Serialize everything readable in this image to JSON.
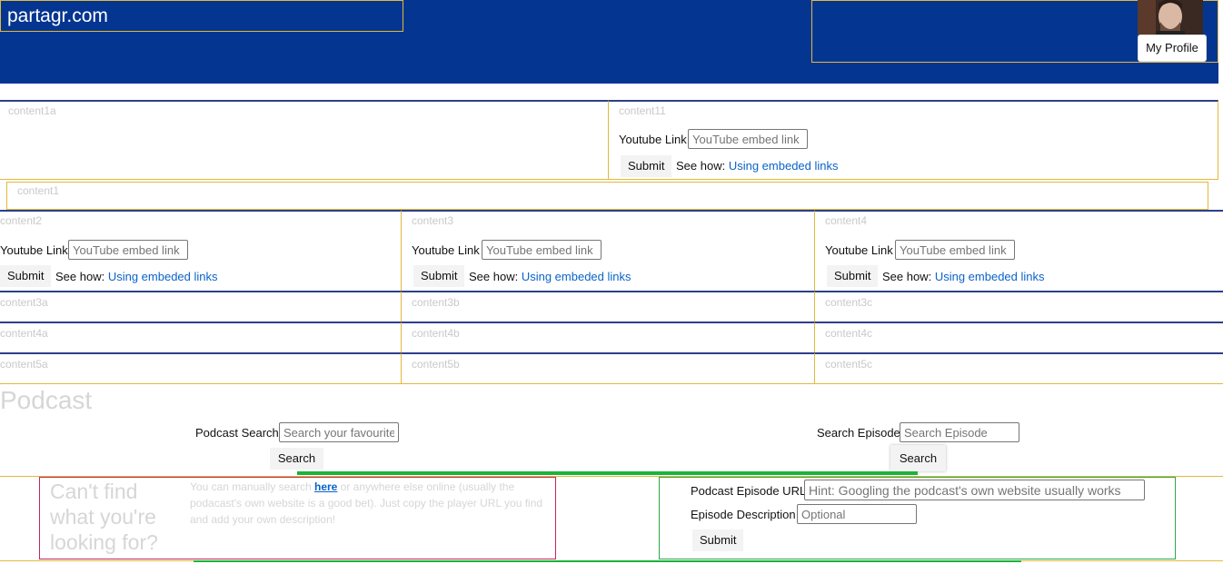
{
  "header": {
    "site_title": "partagr.com",
    "profile_button": "My Profile"
  },
  "top_row": {
    "left_label": "content1a",
    "right_label": "content11",
    "youtube_label": "Youtube Link",
    "youtube_placeholder": "YouTube embed link",
    "submit": "Submit",
    "see_how": "See how:",
    "see_how_link": "Using embeded links"
  },
  "wide_row": {
    "label": "content1"
  },
  "video_cells": [
    {
      "label": "content2",
      "youtube_label": "Youtube Link",
      "youtube_placeholder": "YouTube embed link",
      "submit": "Submit",
      "see_how": "See how:",
      "see_how_link": "Using embeded links"
    },
    {
      "label": "content3",
      "youtube_label": "Youtube Link",
      "youtube_placeholder": "YouTube embed link",
      "submit": "Submit",
      "see_how": "See how:",
      "see_how_link": "Using embeded links"
    },
    {
      "label": "content4",
      "youtube_label": "Youtube Link",
      "youtube_placeholder": "YouTube embed link",
      "submit": "Submit",
      "see_how": "See how:",
      "see_how_link": "Using embeded links"
    }
  ],
  "small_rows": [
    [
      "content3a",
      "content3b",
      "content3c"
    ],
    [
      "content4a",
      "content4b",
      "content4c"
    ],
    [
      "content5a",
      "content5b",
      "content5c"
    ]
  ],
  "podcast": {
    "title": "Podcast",
    "search_label": "Podcast Search",
    "search_placeholder": "Search your favourite podcast",
    "search_button": "Search",
    "episode_label": "Search Episode",
    "episode_placeholder": "Search Episode",
    "episode_button": "Search"
  },
  "cant_find": {
    "title": "Can't find what you're looking for?",
    "text_before": "You can manually search ",
    "link": "here",
    "text_after": " or anywhere else online (usually the podacast's own website is a good bet). Just copy the player URL you find and add your own description!"
  },
  "episode_form": {
    "url_label": "Podcast Episode URL",
    "url_placeholder": "Hint: Googling the podcast's own website usually works",
    "desc_label": "Episode Description",
    "desc_placeholder": "Optional",
    "submit": "Submit"
  },
  "colors": {
    "header_bg": "#043591",
    "cell_border": "#e3b93a",
    "link": "#0a63c9",
    "green": "#1bb33a",
    "red_border": "#c4265a"
  }
}
